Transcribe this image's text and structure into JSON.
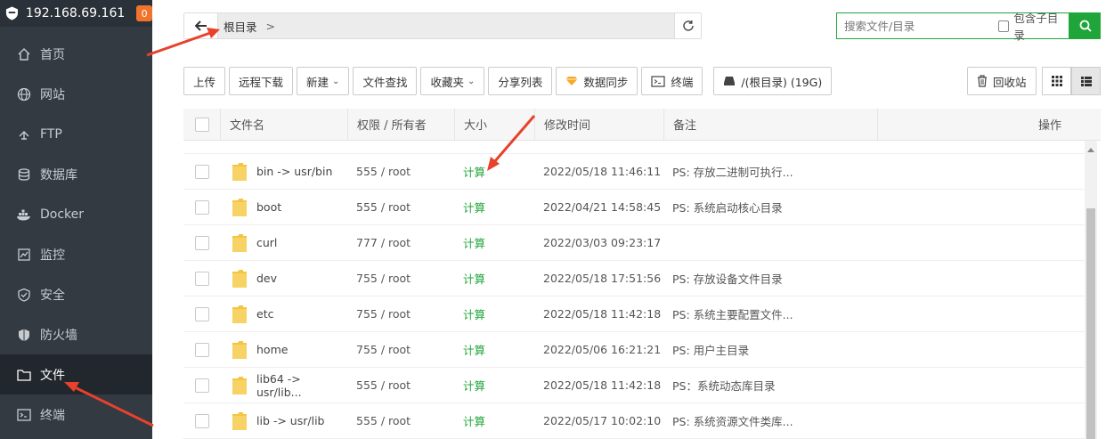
{
  "sidebar": {
    "host": "192.168.69.161",
    "badge": "0",
    "items": [
      {
        "label": "首页",
        "icon": "home-icon"
      },
      {
        "label": "网站",
        "icon": "globe-icon"
      },
      {
        "label": "FTP",
        "icon": "ftp-icon"
      },
      {
        "label": "数据库",
        "icon": "database-icon"
      },
      {
        "label": "Docker",
        "icon": "docker-icon"
      },
      {
        "label": "监控",
        "icon": "monitor-icon"
      },
      {
        "label": "安全",
        "icon": "shield-check-icon"
      },
      {
        "label": "防火墙",
        "icon": "firewall-icon"
      },
      {
        "label": "文件",
        "icon": "folder-icon"
      },
      {
        "label": "终端",
        "icon": "terminal-icon"
      }
    ],
    "active_index": 8
  },
  "path": {
    "root": "根目录",
    "sep": ">"
  },
  "search": {
    "placeholder": "搜索文件/目录",
    "include_sub": "包含子目录"
  },
  "toolbar": {
    "upload": "上传",
    "remote_download": "远程下载",
    "new": "新建",
    "find": "文件查找",
    "favorites": "收藏夹",
    "share_list": "分享列表",
    "sync": "数据同步",
    "terminal": "终端",
    "disk": "/(根目录) (19G)",
    "recycle": "回收站"
  },
  "table": {
    "headers": {
      "name": "文件名",
      "perm": "权限 / 所有者",
      "size": "大小",
      "time": "修改时间",
      "note": "备注",
      "op": "操作"
    },
    "rows": [
      {
        "name": "bin -> usr/bin",
        "perm": "555 / root",
        "size": "计算",
        "time": "2022/05/18 11:46:11",
        "note": "PS: 存放二进制可执行..."
      },
      {
        "name": "boot",
        "perm": "555 / root",
        "size": "计算",
        "time": "2022/04/21 14:58:45",
        "note": "PS: 系统启动核心目录"
      },
      {
        "name": "curl",
        "perm": "777 / root",
        "size": "计算",
        "time": "2022/03/03 09:23:17",
        "note": ""
      },
      {
        "name": "dev",
        "perm": "755 / root",
        "size": "计算",
        "time": "2022/05/18 17:51:56",
        "note": "PS: 存放设备文件目录"
      },
      {
        "name": "etc",
        "perm": "755 / root",
        "size": "计算",
        "time": "2022/05/18 11:42:18",
        "note": "PS: 系统主要配置文件..."
      },
      {
        "name": "home",
        "perm": "755 / root",
        "size": "计算",
        "time": "2022/05/06 16:21:21",
        "note": "PS: 用户主目录"
      },
      {
        "name": "lib64 -> usr/lib...",
        "perm": "555 / root",
        "size": "计算",
        "time": "2022/05/18 11:42:18",
        "note": " PS：系统动态库目录"
      },
      {
        "name": "lib -> usr/lib",
        "perm": "555 / root",
        "size": "计算",
        "time": "2022/05/17 10:02:10",
        "note": "PS: 系统资源文件类库..."
      }
    ]
  },
  "colors": {
    "accent": "#20a53a",
    "arrow": "#e8412c",
    "sidebar_bg": "#333a42"
  }
}
